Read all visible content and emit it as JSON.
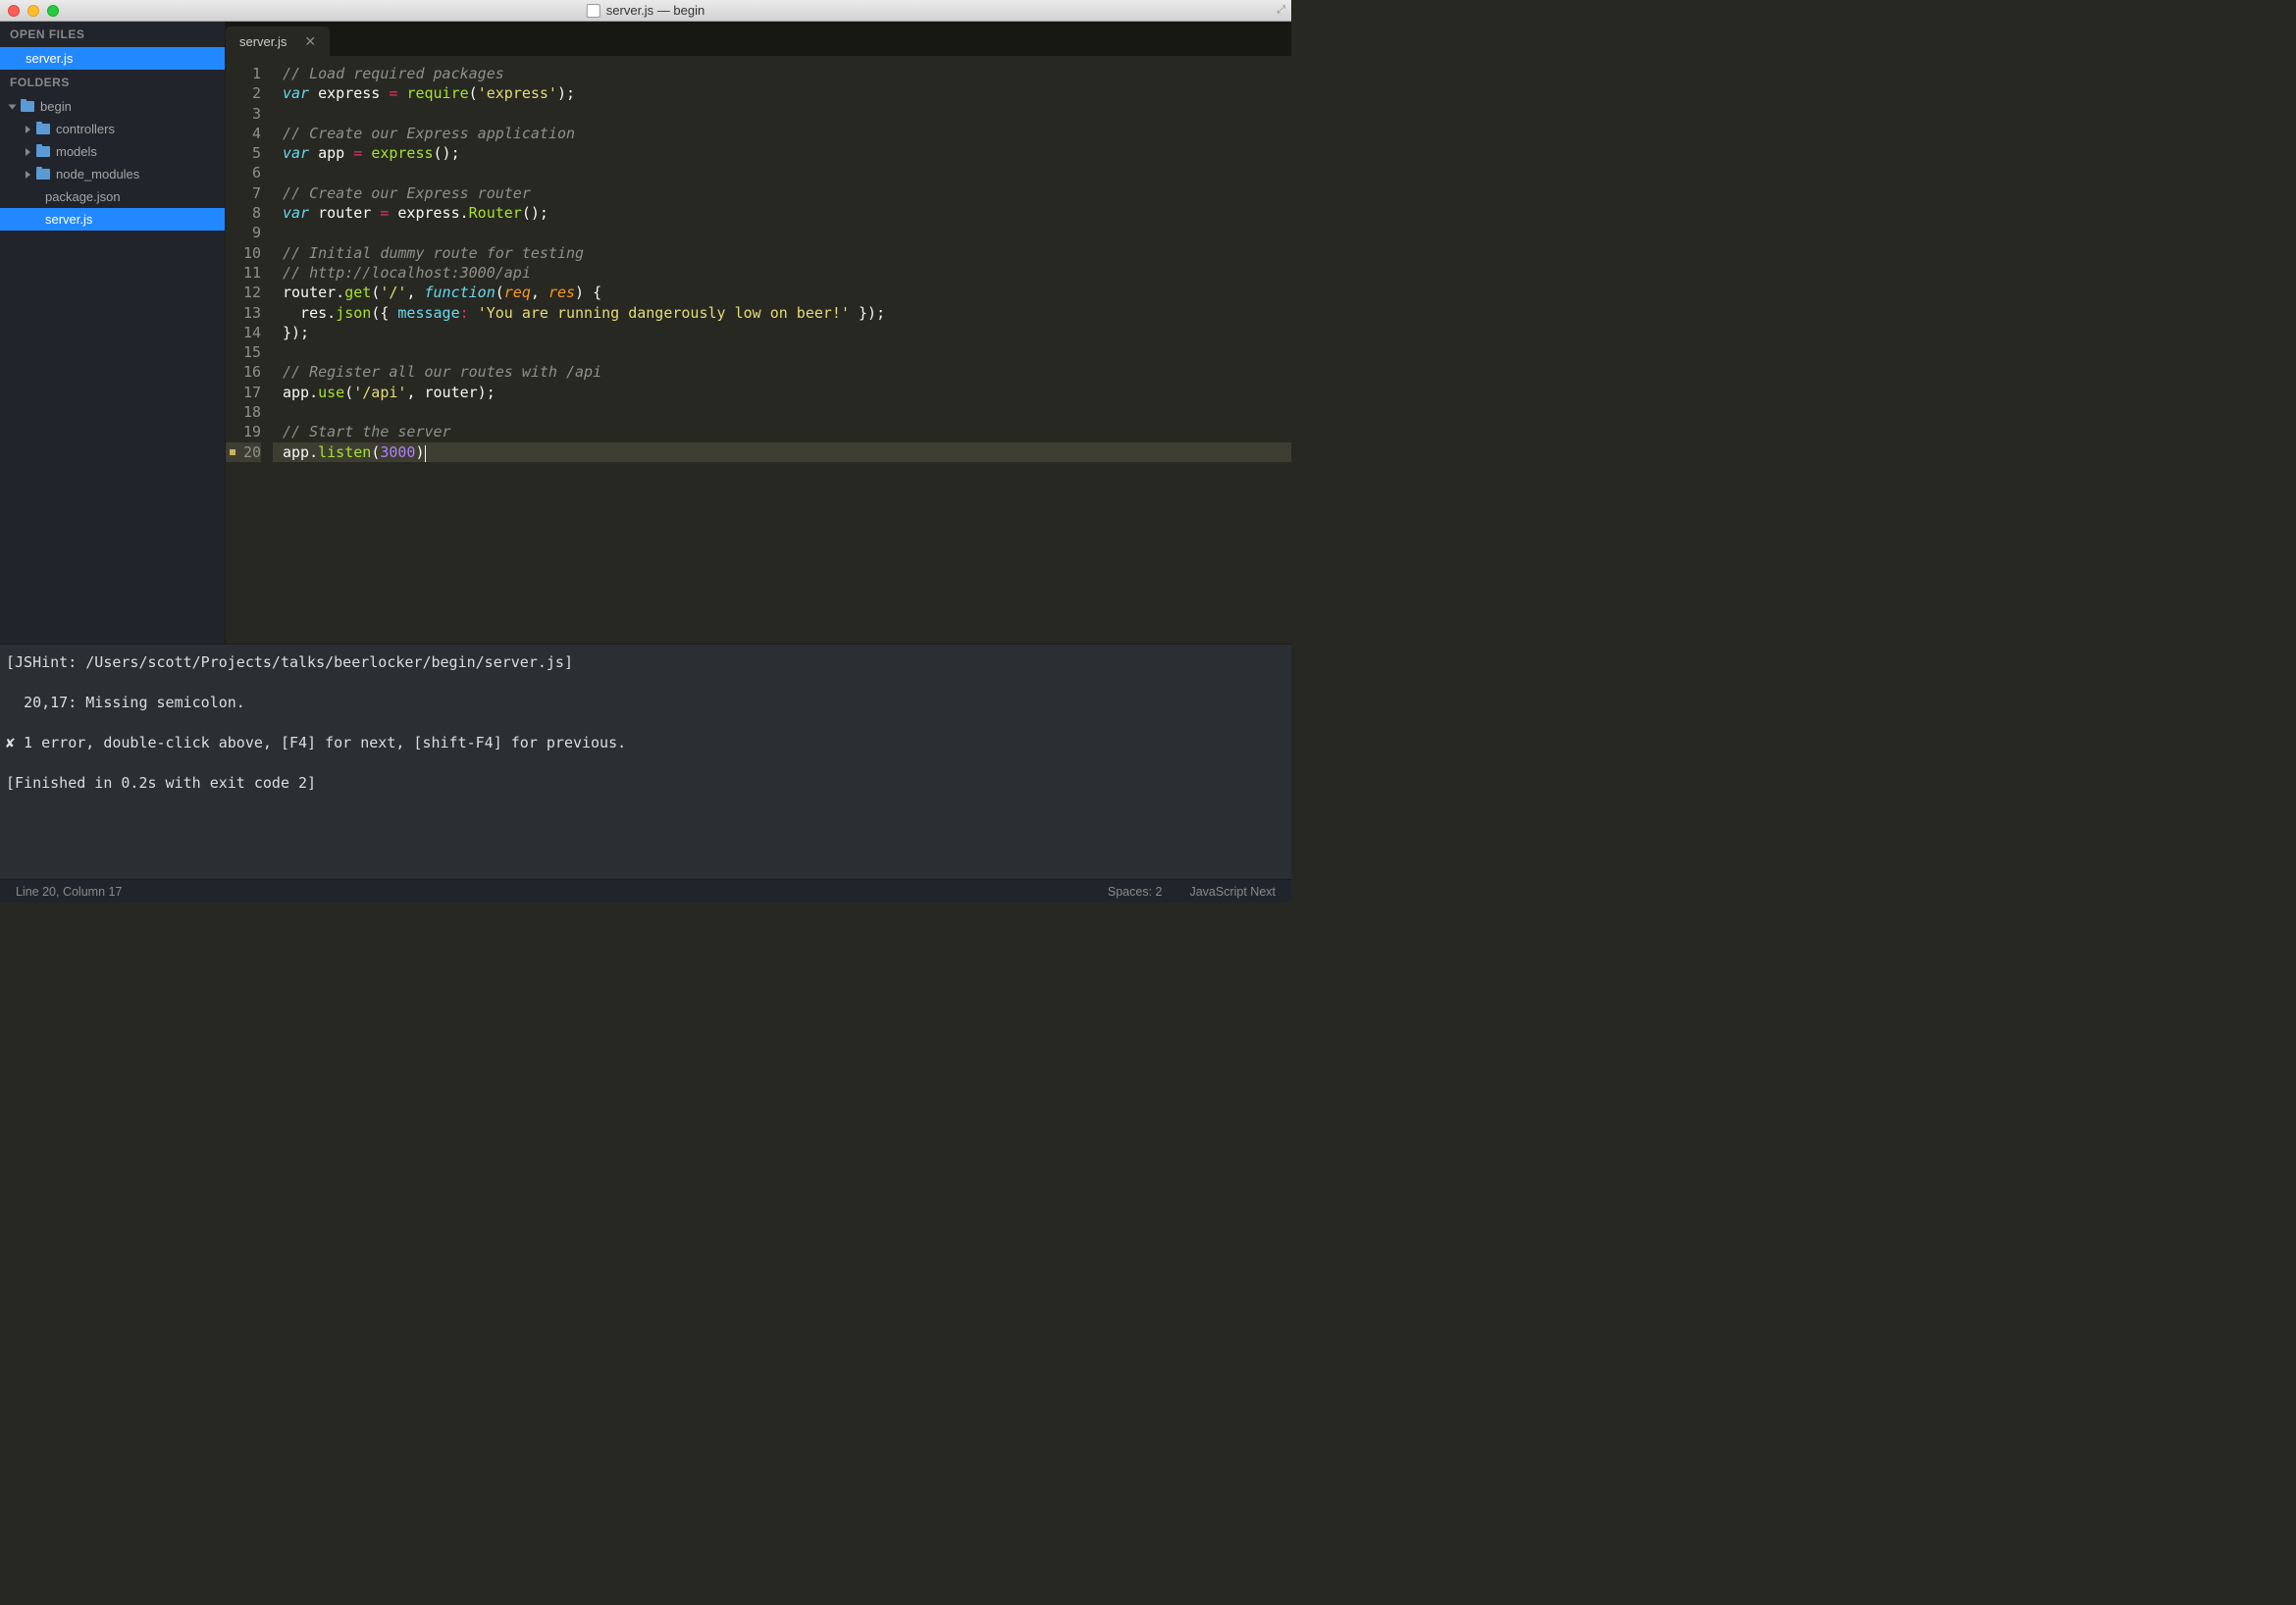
{
  "window": {
    "title": "server.js — begin"
  },
  "sidebar": {
    "open_files_header": "OPEN FILES",
    "open_files": [
      {
        "name": "server.js",
        "selected": true
      }
    ],
    "folders_header": "FOLDERS",
    "root": {
      "name": "begin",
      "children": [
        {
          "type": "folder",
          "name": "controllers"
        },
        {
          "type": "folder",
          "name": "models"
        },
        {
          "type": "folder",
          "name": "node_modules"
        },
        {
          "type": "file",
          "name": "package.json"
        },
        {
          "type": "file",
          "name": "server.js",
          "selected": true
        }
      ]
    }
  },
  "tabs": [
    {
      "name": "server.js",
      "active": true
    }
  ],
  "editor": {
    "lines": [
      {
        "n": 1,
        "tokens": [
          [
            "comment",
            "// Load required packages"
          ]
        ]
      },
      {
        "n": 2,
        "tokens": [
          [
            "storage",
            "var"
          ],
          [
            "plain",
            " express "
          ],
          [
            "operator",
            "="
          ],
          [
            "plain",
            " "
          ],
          [
            "call",
            "require"
          ],
          [
            "plain",
            "("
          ],
          [
            "string",
            "'express'"
          ],
          [
            "plain",
            ");"
          ]
        ]
      },
      {
        "n": 3,
        "tokens": []
      },
      {
        "n": 4,
        "tokens": [
          [
            "comment",
            "// Create our Express application"
          ]
        ]
      },
      {
        "n": 5,
        "tokens": [
          [
            "storage",
            "var"
          ],
          [
            "plain",
            " app "
          ],
          [
            "operator",
            "="
          ],
          [
            "plain",
            " "
          ],
          [
            "call",
            "express"
          ],
          [
            "plain",
            "();"
          ]
        ]
      },
      {
        "n": 6,
        "tokens": []
      },
      {
        "n": 7,
        "tokens": [
          [
            "comment",
            "// Create our Express router"
          ]
        ]
      },
      {
        "n": 8,
        "tokens": [
          [
            "storage",
            "var"
          ],
          [
            "plain",
            " router "
          ],
          [
            "operator",
            "="
          ],
          [
            "plain",
            " express."
          ],
          [
            "call",
            "Router"
          ],
          [
            "plain",
            "();"
          ]
        ]
      },
      {
        "n": 9,
        "tokens": []
      },
      {
        "n": 10,
        "tokens": [
          [
            "comment",
            "// Initial dummy route for testing"
          ]
        ]
      },
      {
        "n": 11,
        "tokens": [
          [
            "comment",
            "// http://localhost:3000/api"
          ]
        ]
      },
      {
        "n": 12,
        "tokens": [
          [
            "plain",
            "router."
          ],
          [
            "call",
            "get"
          ],
          [
            "plain",
            "("
          ],
          [
            "string",
            "'/'"
          ],
          [
            "plain",
            ", "
          ],
          [
            "storage",
            "function"
          ],
          [
            "plain",
            "("
          ],
          [
            "param",
            "req"
          ],
          [
            "plain",
            ", "
          ],
          [
            "param",
            "res"
          ],
          [
            "plain",
            ") {"
          ]
        ]
      },
      {
        "n": 13,
        "tokens": [
          [
            "plain",
            "  res."
          ],
          [
            "call",
            "json"
          ],
          [
            "plain",
            "({ "
          ],
          [
            "prop",
            "message"
          ],
          [
            "operator",
            ":"
          ],
          [
            "plain",
            " "
          ],
          [
            "string",
            "'You are running dangerously low on beer!'"
          ],
          [
            "plain",
            " });"
          ]
        ]
      },
      {
        "n": 14,
        "tokens": [
          [
            "plain",
            "});"
          ]
        ]
      },
      {
        "n": 15,
        "tokens": []
      },
      {
        "n": 16,
        "tokens": [
          [
            "comment",
            "// Register all our routes with /api"
          ]
        ]
      },
      {
        "n": 17,
        "tokens": [
          [
            "plain",
            "app."
          ],
          [
            "call",
            "use"
          ],
          [
            "plain",
            "("
          ],
          [
            "string",
            "'/api'"
          ],
          [
            "plain",
            ", router);"
          ]
        ]
      },
      {
        "n": 18,
        "tokens": []
      },
      {
        "n": 19,
        "tokens": [
          [
            "comment",
            "// Start the server"
          ]
        ]
      },
      {
        "n": 20,
        "tokens": [
          [
            "plain",
            "app."
          ],
          [
            "call",
            "listen"
          ],
          [
            "plain",
            "("
          ],
          [
            "number",
            "3000"
          ],
          [
            "plain",
            ")"
          ]
        ],
        "current": true,
        "warning": true
      }
    ]
  },
  "console": {
    "lines": [
      "[JSHint: /Users/scott/Projects/talks/beerlocker/begin/server.js]",
      "",
      "  20,17: Missing semicolon.",
      "",
      "✘ 1 error, double-click above, [F4] for next, [shift-F4] for previous.",
      "",
      "[Finished in 0.2s with exit code 2]"
    ]
  },
  "statusbar": {
    "position": "Line 20, Column 17",
    "spaces": "Spaces: 2",
    "syntax": "JavaScript Next"
  }
}
